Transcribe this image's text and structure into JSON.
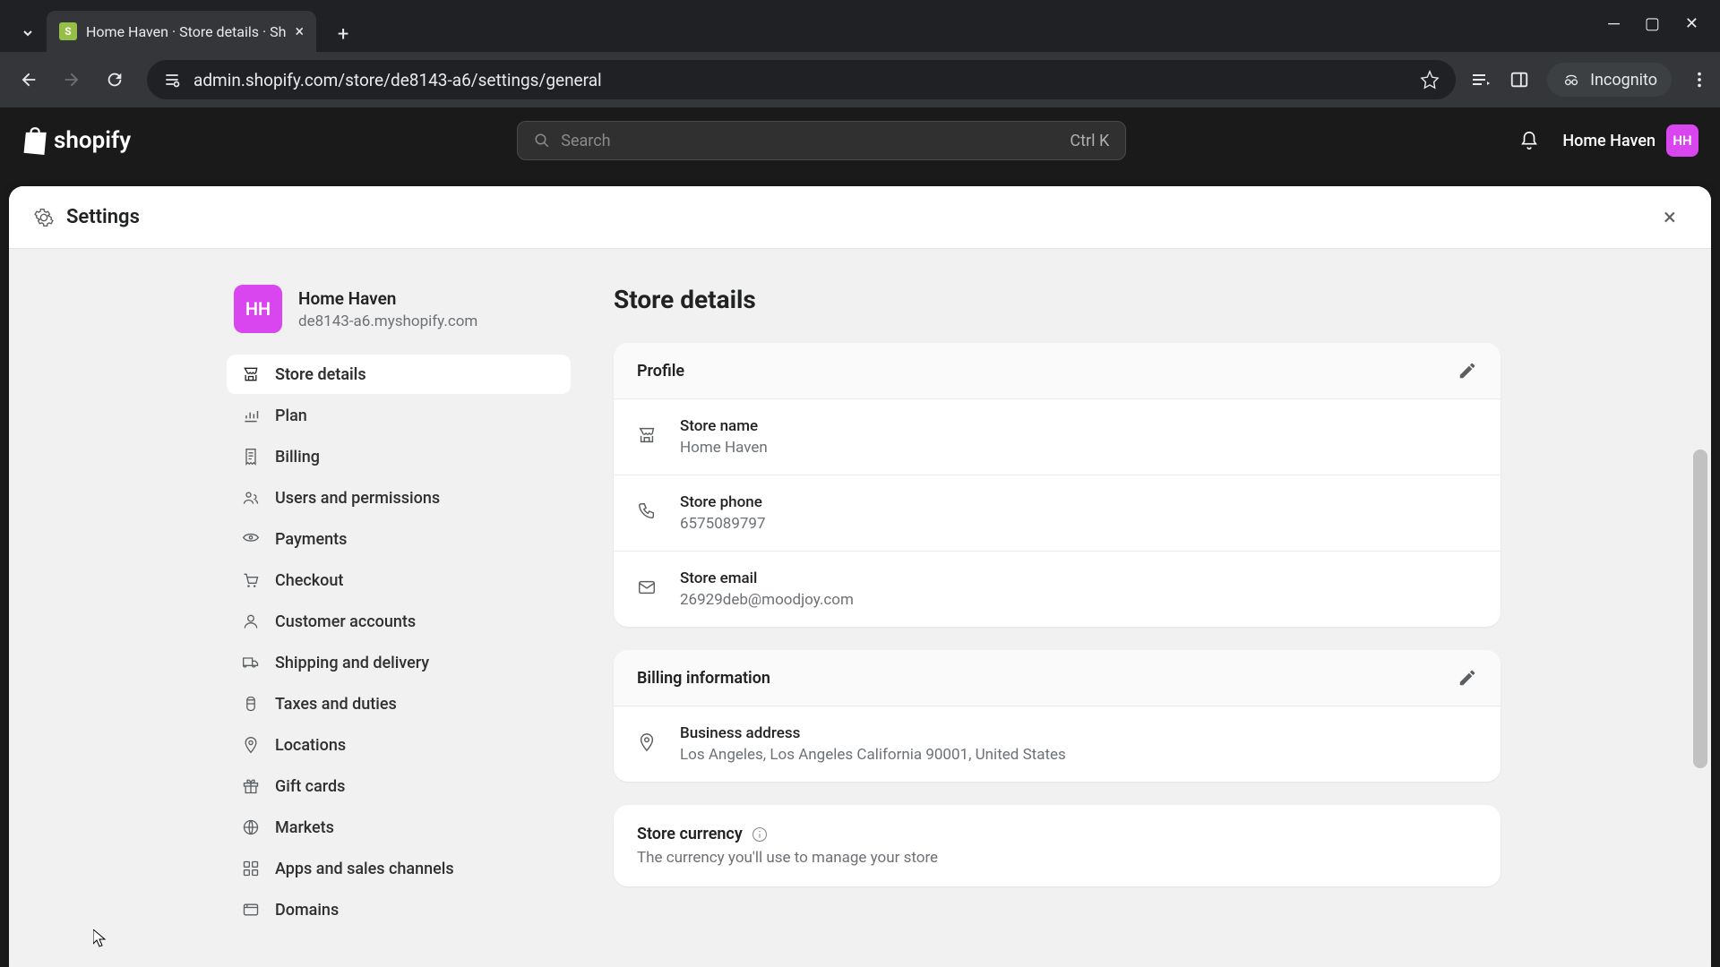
{
  "browser": {
    "tab_title": "Home Haven · Store details · Sh",
    "url": "admin.shopify.com/store/de8143-a6/settings/general",
    "incognito_label": "Incognito"
  },
  "topbar": {
    "logo_text": "shopify",
    "search_placeholder": "Search",
    "search_shortcut": "Ctrl K",
    "account_name": "Home Haven",
    "account_initials": "HH"
  },
  "settings": {
    "header_title": "Settings",
    "store": {
      "initials": "HH",
      "name": "Home Haven",
      "url": "de8143-a6.myshopify.com"
    },
    "nav": [
      {
        "label": "Store details",
        "icon": "store",
        "active": true
      },
      {
        "label": "Plan",
        "icon": "chart",
        "active": false
      },
      {
        "label": "Billing",
        "icon": "receipt",
        "active": false
      },
      {
        "label": "Users and permissions",
        "icon": "users",
        "active": false
      },
      {
        "label": "Payments",
        "icon": "payments",
        "active": false
      },
      {
        "label": "Checkout",
        "icon": "cart",
        "active": false
      },
      {
        "label": "Customer accounts",
        "icon": "person",
        "active": false
      },
      {
        "label": "Shipping and delivery",
        "icon": "truck",
        "active": false
      },
      {
        "label": "Taxes and duties",
        "icon": "tax",
        "active": false
      },
      {
        "label": "Locations",
        "icon": "pin",
        "active": false
      },
      {
        "label": "Gift cards",
        "icon": "gift",
        "active": false
      },
      {
        "label": "Markets",
        "icon": "globe",
        "active": false
      },
      {
        "label": "Apps and sales channels",
        "icon": "apps",
        "active": false
      },
      {
        "label": "Domains",
        "icon": "domain",
        "active": false
      }
    ],
    "page_title": "Store details",
    "profile": {
      "title": "Profile",
      "fields": [
        {
          "label": "Store name",
          "value": "Home Haven",
          "icon": "store"
        },
        {
          "label": "Store phone",
          "value": "6575089797",
          "icon": "phone"
        },
        {
          "label": "Store email",
          "value": "26929deb@moodjoy.com",
          "icon": "mail"
        }
      ]
    },
    "billing": {
      "title": "Billing information",
      "fields": [
        {
          "label": "Business address",
          "value": "Los Angeles, Los Angeles California 90001, United States",
          "icon": "location"
        }
      ]
    },
    "currency": {
      "title": "Store currency",
      "description": "The currency you'll use to manage your store"
    }
  }
}
